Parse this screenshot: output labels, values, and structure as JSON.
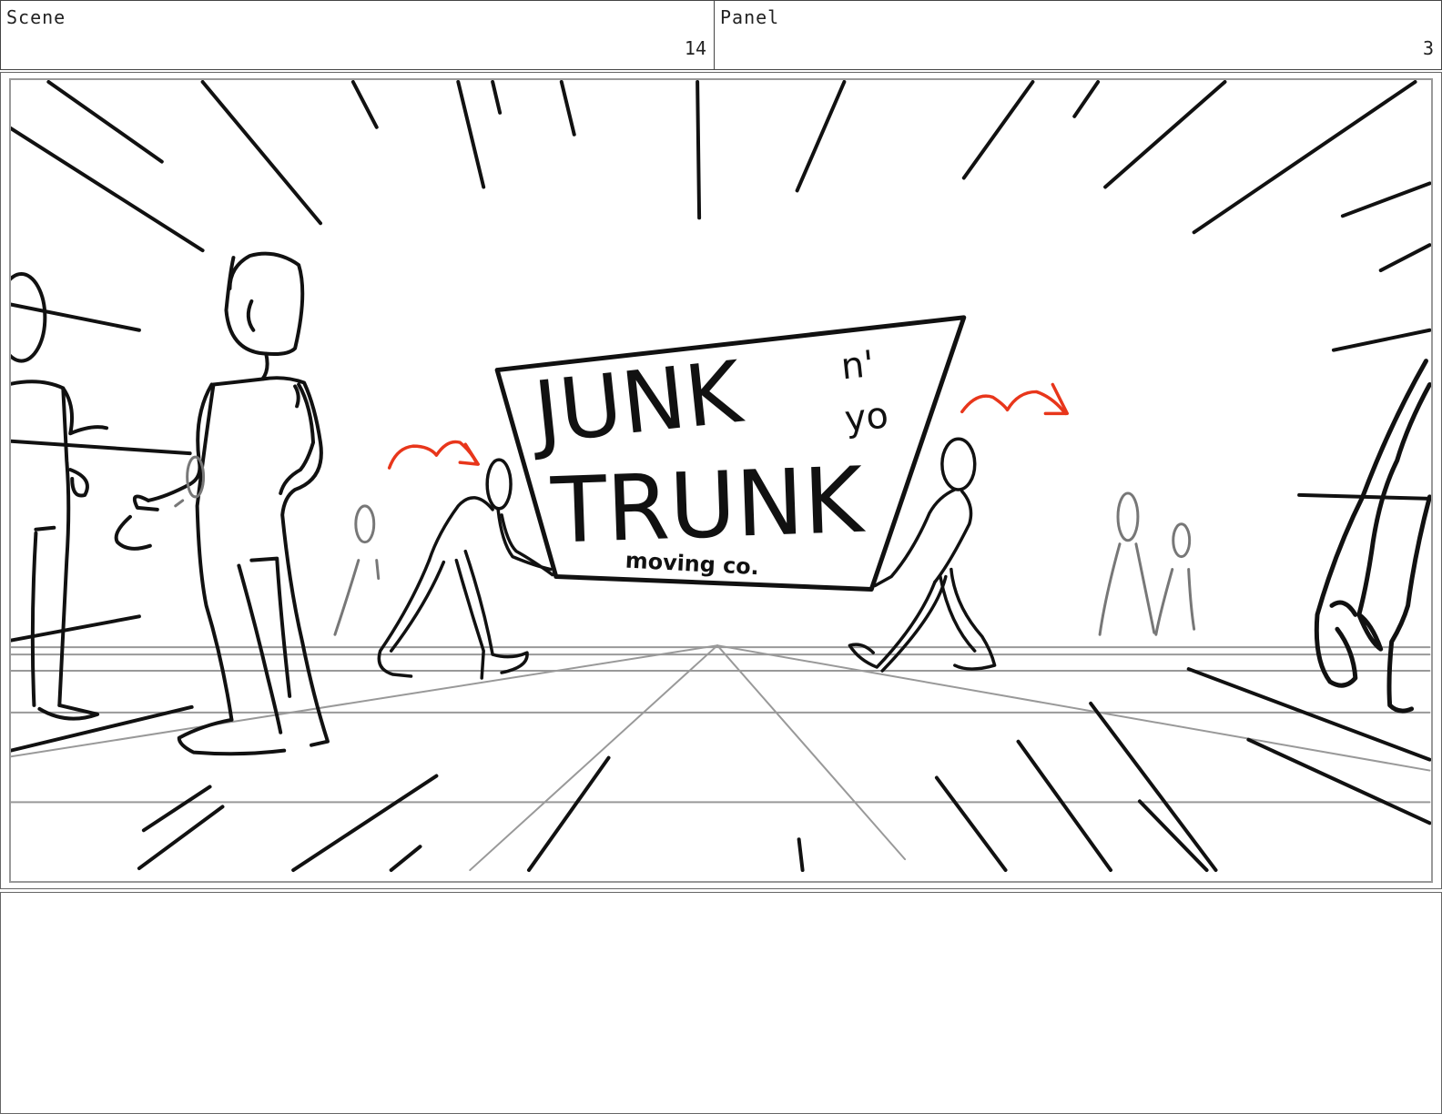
{
  "header": {
    "scene_label": "Scene",
    "scene_number": "14",
    "panel_label": "Panel",
    "panel_number": "3"
  },
  "sign": {
    "line1": "JUNK",
    "line2": "n'",
    "line3": "yo",
    "line4": "TRUNK",
    "line5": "moving co."
  },
  "colors": {
    "ink": "#111111",
    "guide_gray": "#999999",
    "background_figure_gray": "#777777",
    "motion_arrow": "#e8361b",
    "frame_border": "#999999"
  }
}
